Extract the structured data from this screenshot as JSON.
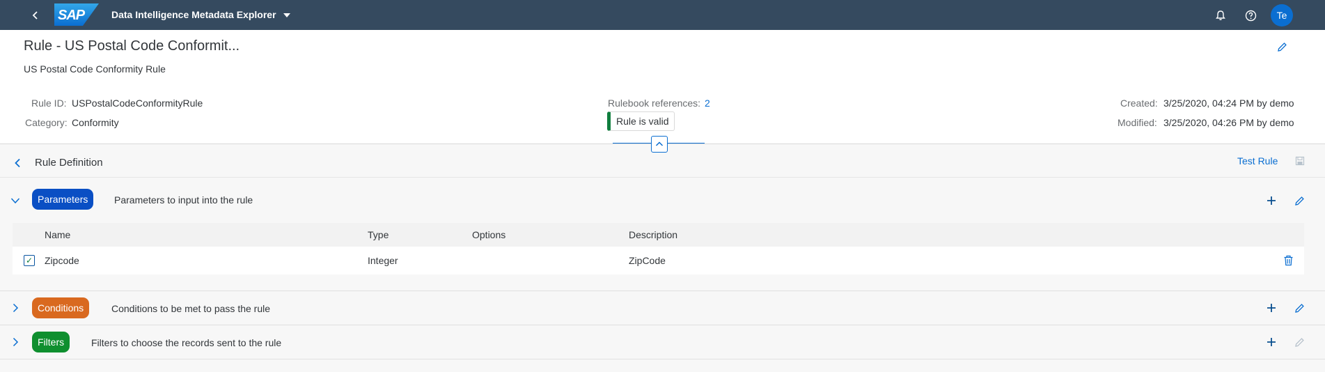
{
  "shell": {
    "logo_text": "SAP",
    "app_title": "Data Intelligence Metadata Explorer",
    "user_initials": "Te",
    "icons": [
      "back-icon",
      "chevron-down-icon",
      "bell-icon",
      "help-icon"
    ]
  },
  "header": {
    "title": "Rule - US Postal Code Conformit...",
    "subtitle": "US Postal Code Conformity Rule",
    "rule_id_label": "Rule ID:",
    "rule_id_value": "USPostalCodeConformityRule",
    "category_label": "Category:",
    "category_value": "Conformity",
    "rulebook_label": "Rulebook references:",
    "rulebook_value": "2",
    "status_text": "Rule is valid",
    "created_label": "Created:",
    "created_value": "3/25/2020, 04:24 PM by demo",
    "modified_label": "Modified:",
    "modified_value": "3/25/2020, 04:26 PM by demo"
  },
  "section": {
    "title": "Rule Definition",
    "test_rule_label": "Test Rule"
  },
  "parameters": {
    "pill_label": "Parameters",
    "pill_color": "#0a4fc4",
    "description": "Parameters to input into the rule",
    "columns": [
      "Name",
      "Type",
      "Options",
      "Description"
    ],
    "rows": [
      {
        "name": "Zipcode",
        "type": "Integer",
        "options": "",
        "description": "ZipCode"
      }
    ]
  },
  "conditions": {
    "pill_label": "Conditions",
    "pill_color": "#d9691f",
    "description": "Conditions to be met to pass the rule"
  },
  "filters": {
    "pill_label": "Filters",
    "pill_color": "#0f8f2f",
    "description": "Filters to choose the records sent to the rule"
  }
}
